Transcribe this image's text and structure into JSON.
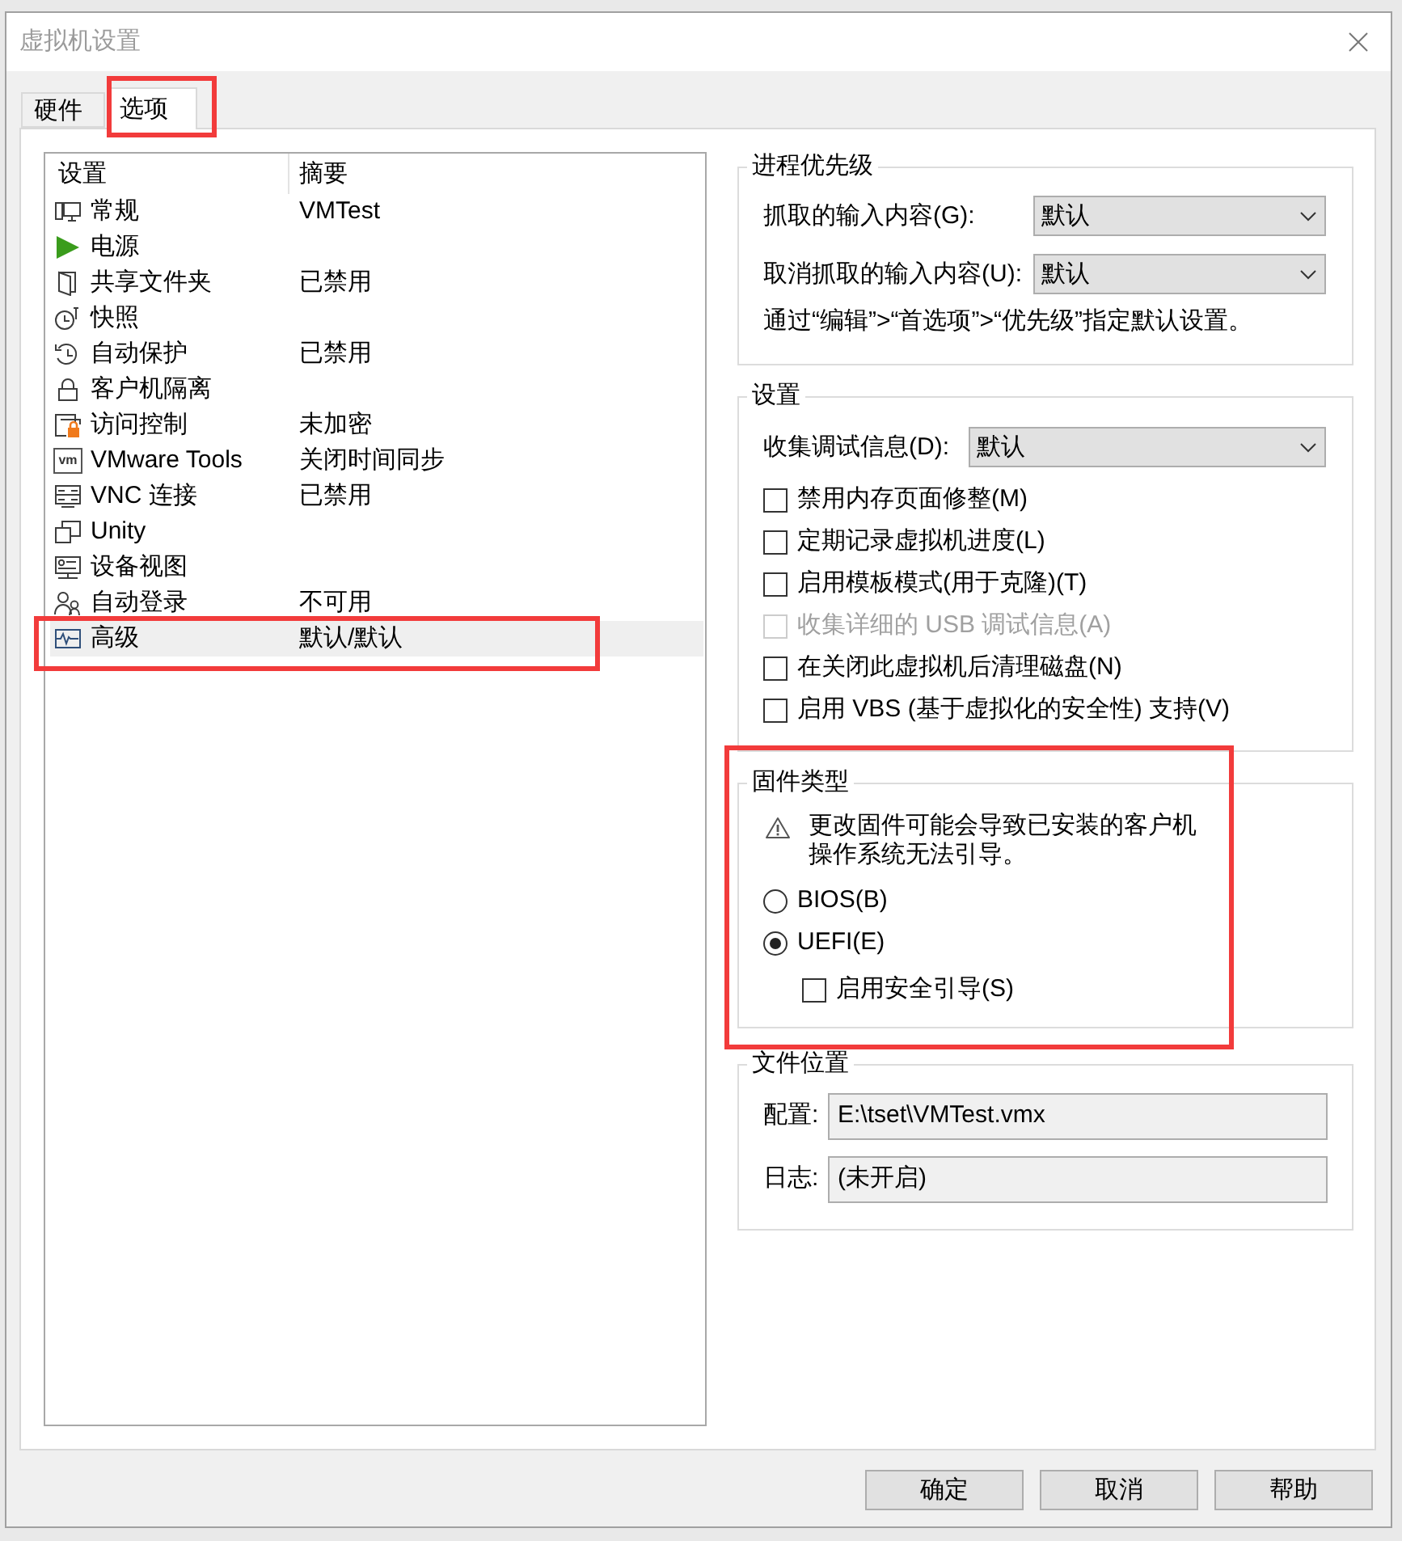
{
  "window": {
    "title": "虚拟机设置"
  },
  "tabs": [
    {
      "label": "硬件",
      "selected": false,
      "highlighted": false
    },
    {
      "label": "选项",
      "selected": true,
      "highlighted": true
    }
  ],
  "settings_list": {
    "columns": [
      "设置",
      "摘要"
    ],
    "items": [
      {
        "name": "常规",
        "summary": "VMTest",
        "selected": false,
        "highlighted": false
      },
      {
        "name": "电源",
        "selected": false,
        "highlighted": false
      },
      {
        "name": "共享文件夹",
        "summary": "已禁用",
        "selected": false,
        "highlighted": false
      },
      {
        "name": "快照",
        "selected": false,
        "highlighted": false
      },
      {
        "name": "自动保护",
        "summary": "已禁用",
        "selected": false,
        "highlighted": false
      },
      {
        "name": "客户机隔离",
        "selected": false,
        "highlighted": false
      },
      {
        "name": "访问控制",
        "summary": "未加密",
        "selected": false,
        "highlighted": false
      },
      {
        "name": "VMware Tools",
        "summary": "关闭时间同步",
        "logo": "vm",
        "selected": false,
        "highlighted": false
      },
      {
        "name": "VNC 连接",
        "summary": "已禁用",
        "selected": false,
        "highlighted": false
      },
      {
        "name": "Unity",
        "selected": false,
        "highlighted": false
      },
      {
        "name": "设备视图",
        "selected": false,
        "highlighted": false
      },
      {
        "name": "自动登录",
        "summary": "不可用",
        "selected": false,
        "highlighted": false
      },
      {
        "name": "高级",
        "summary": "默认/默认",
        "selected": true,
        "highlighted": true
      }
    ]
  },
  "process_priority": {
    "title": "进程优先级",
    "fields": [
      {
        "label": "抓取的输入内容(G):",
        "value": "默认"
      },
      {
        "label": "取消抓取的输入内容(U):",
        "value": "默认"
      }
    ],
    "note": "通过“编辑”>“首选项”>“优先级”指定默认设置。"
  },
  "settings": {
    "title": "设置",
    "debug": {
      "label": "收集调试信息(D):",
      "value": "默认"
    },
    "options": [
      {
        "label": "禁用内存页面修整(M)",
        "checked": false,
        "disabled": false
      },
      {
        "label": "定期记录虚拟机进度(L)",
        "checked": false,
        "disabled": false
      },
      {
        "label": "启用模板模式(用于克隆)(T)",
        "checked": false,
        "disabled": false
      },
      {
        "label": "收集详细的 USB 调试信息(A)",
        "checked": false,
        "disabled": true
      },
      {
        "label": "在关闭此虚拟机后清理磁盘(N)",
        "checked": false,
        "disabled": false
      },
      {
        "label": "启用 VBS (基于虚拟化的安全性) 支持(V)",
        "checked": false,
        "disabled": false
      }
    ]
  },
  "firmware": {
    "title": "固件类型",
    "highlighted": true,
    "warning": "更改固件可能会导致已安装的客户机操作系统无法引导。",
    "types": [
      {
        "label": "BIOS(B)",
        "selected": false
      },
      {
        "label": "UEFI(E)",
        "selected": true
      }
    ],
    "secure_boot": {
      "label": "启用安全引导(S)",
      "checked": false
    }
  },
  "file_location": {
    "title": "文件位置",
    "fields": [
      {
        "label": "配置:",
        "value": "E:\\tset\\VMTest.vmx"
      },
      {
        "label": "日志:",
        "value": "(未开启)"
      }
    ]
  },
  "buttons": [
    "确定",
    "取消",
    "帮助"
  ]
}
